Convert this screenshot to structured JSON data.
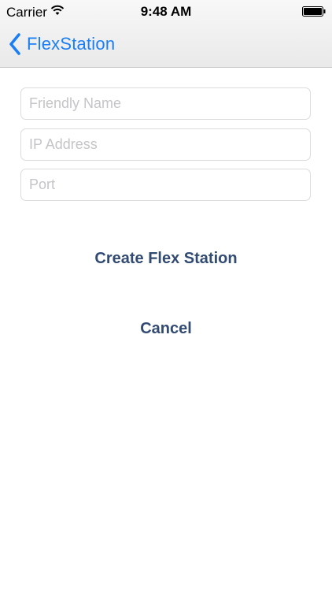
{
  "status_bar": {
    "carrier": "Carrier",
    "time": "9:48 AM",
    "wifi_icon": "wifi-icon",
    "battery_icon": "battery-icon"
  },
  "nav": {
    "back_label": "FlexStation",
    "back_icon": "chevron-left-icon",
    "accent_color": "#1a7ef5"
  },
  "form": {
    "friendly_name": {
      "value": "",
      "placeholder": "Friendly Name"
    },
    "ip_address": {
      "value": "",
      "placeholder": "IP Address"
    },
    "port": {
      "value": "",
      "placeholder": "Port"
    }
  },
  "actions": {
    "create_label": "Create Flex Station",
    "cancel_label": "Cancel",
    "button_color": "#324b73"
  }
}
